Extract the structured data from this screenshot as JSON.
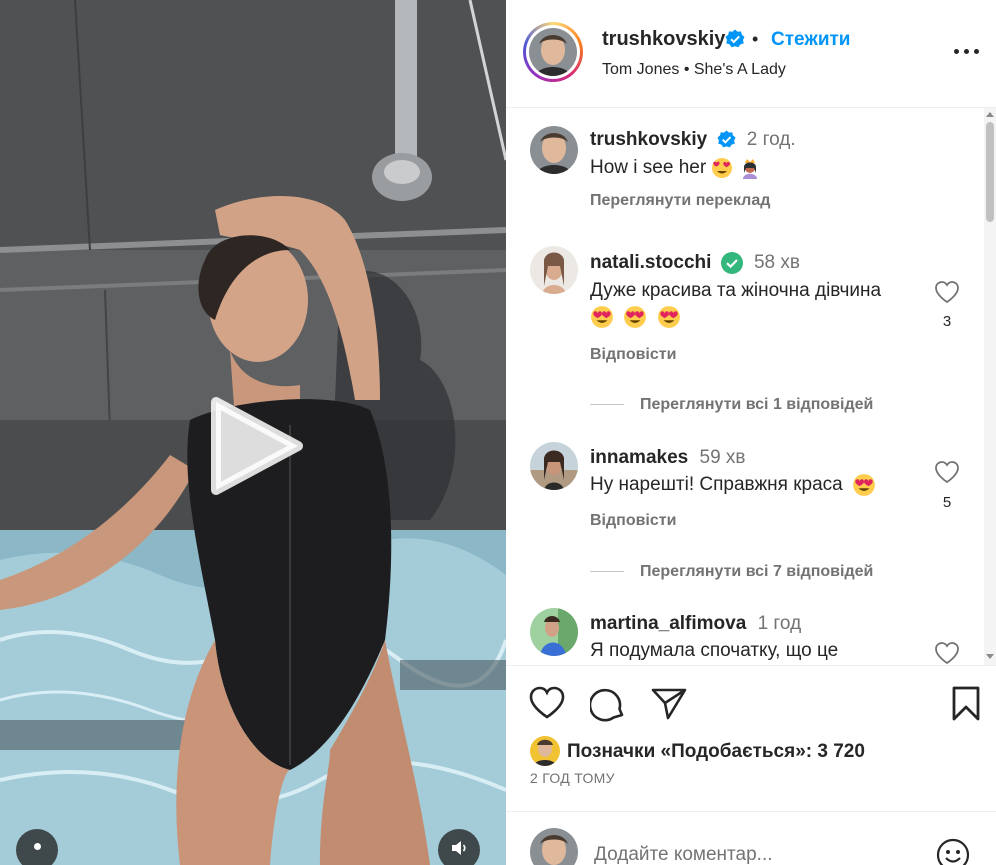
{
  "post": {
    "author": "trushkovskiy",
    "follow_label": "Стежити",
    "separator": "•",
    "audio": "Tom Jones • She's A Lady"
  },
  "caption": {
    "username": "trushkovskiy",
    "time": "2 год.",
    "text": "How i see her",
    "translate_label": "Переглянути переклад"
  },
  "comments": [
    {
      "username": "natali.stocchi",
      "time": "58 хв",
      "text": "Дуже красива та жіночна дівчина",
      "likes": "3",
      "reply_label": "Відповісти",
      "view_replies": "Переглянути всі 1 відповідей"
    },
    {
      "username": "innamakes",
      "time": "59 хв",
      "text": "Ну нарешті! Справжня краса",
      "likes": "5",
      "reply_label": "Відповісти",
      "view_replies": "Переглянути всі 7 відповідей"
    },
    {
      "username": "martina_alfimova",
      "time": "1 год",
      "text": "Я подумала спочатку, що це"
    }
  ],
  "footer": {
    "likes_text": "Позначки «Подобається»: 3 720",
    "posted_time": "2 ГОД ТОМУ",
    "comment_placeholder": "Додайте коментар..."
  },
  "icons": {
    "verified": "verified-badge-icon",
    "like": "heart-icon",
    "comment": "comment-bubble-icon",
    "share": "paper-plane-icon",
    "save": "bookmark-icon",
    "more": "more-dots-icon",
    "emoji": "smiley-icon",
    "play": "play-icon",
    "audio": "speaker-icon"
  },
  "colors": {
    "accent": "#0095f6",
    "verified": "#0095f6",
    "secondary_text": "#737373"
  }
}
